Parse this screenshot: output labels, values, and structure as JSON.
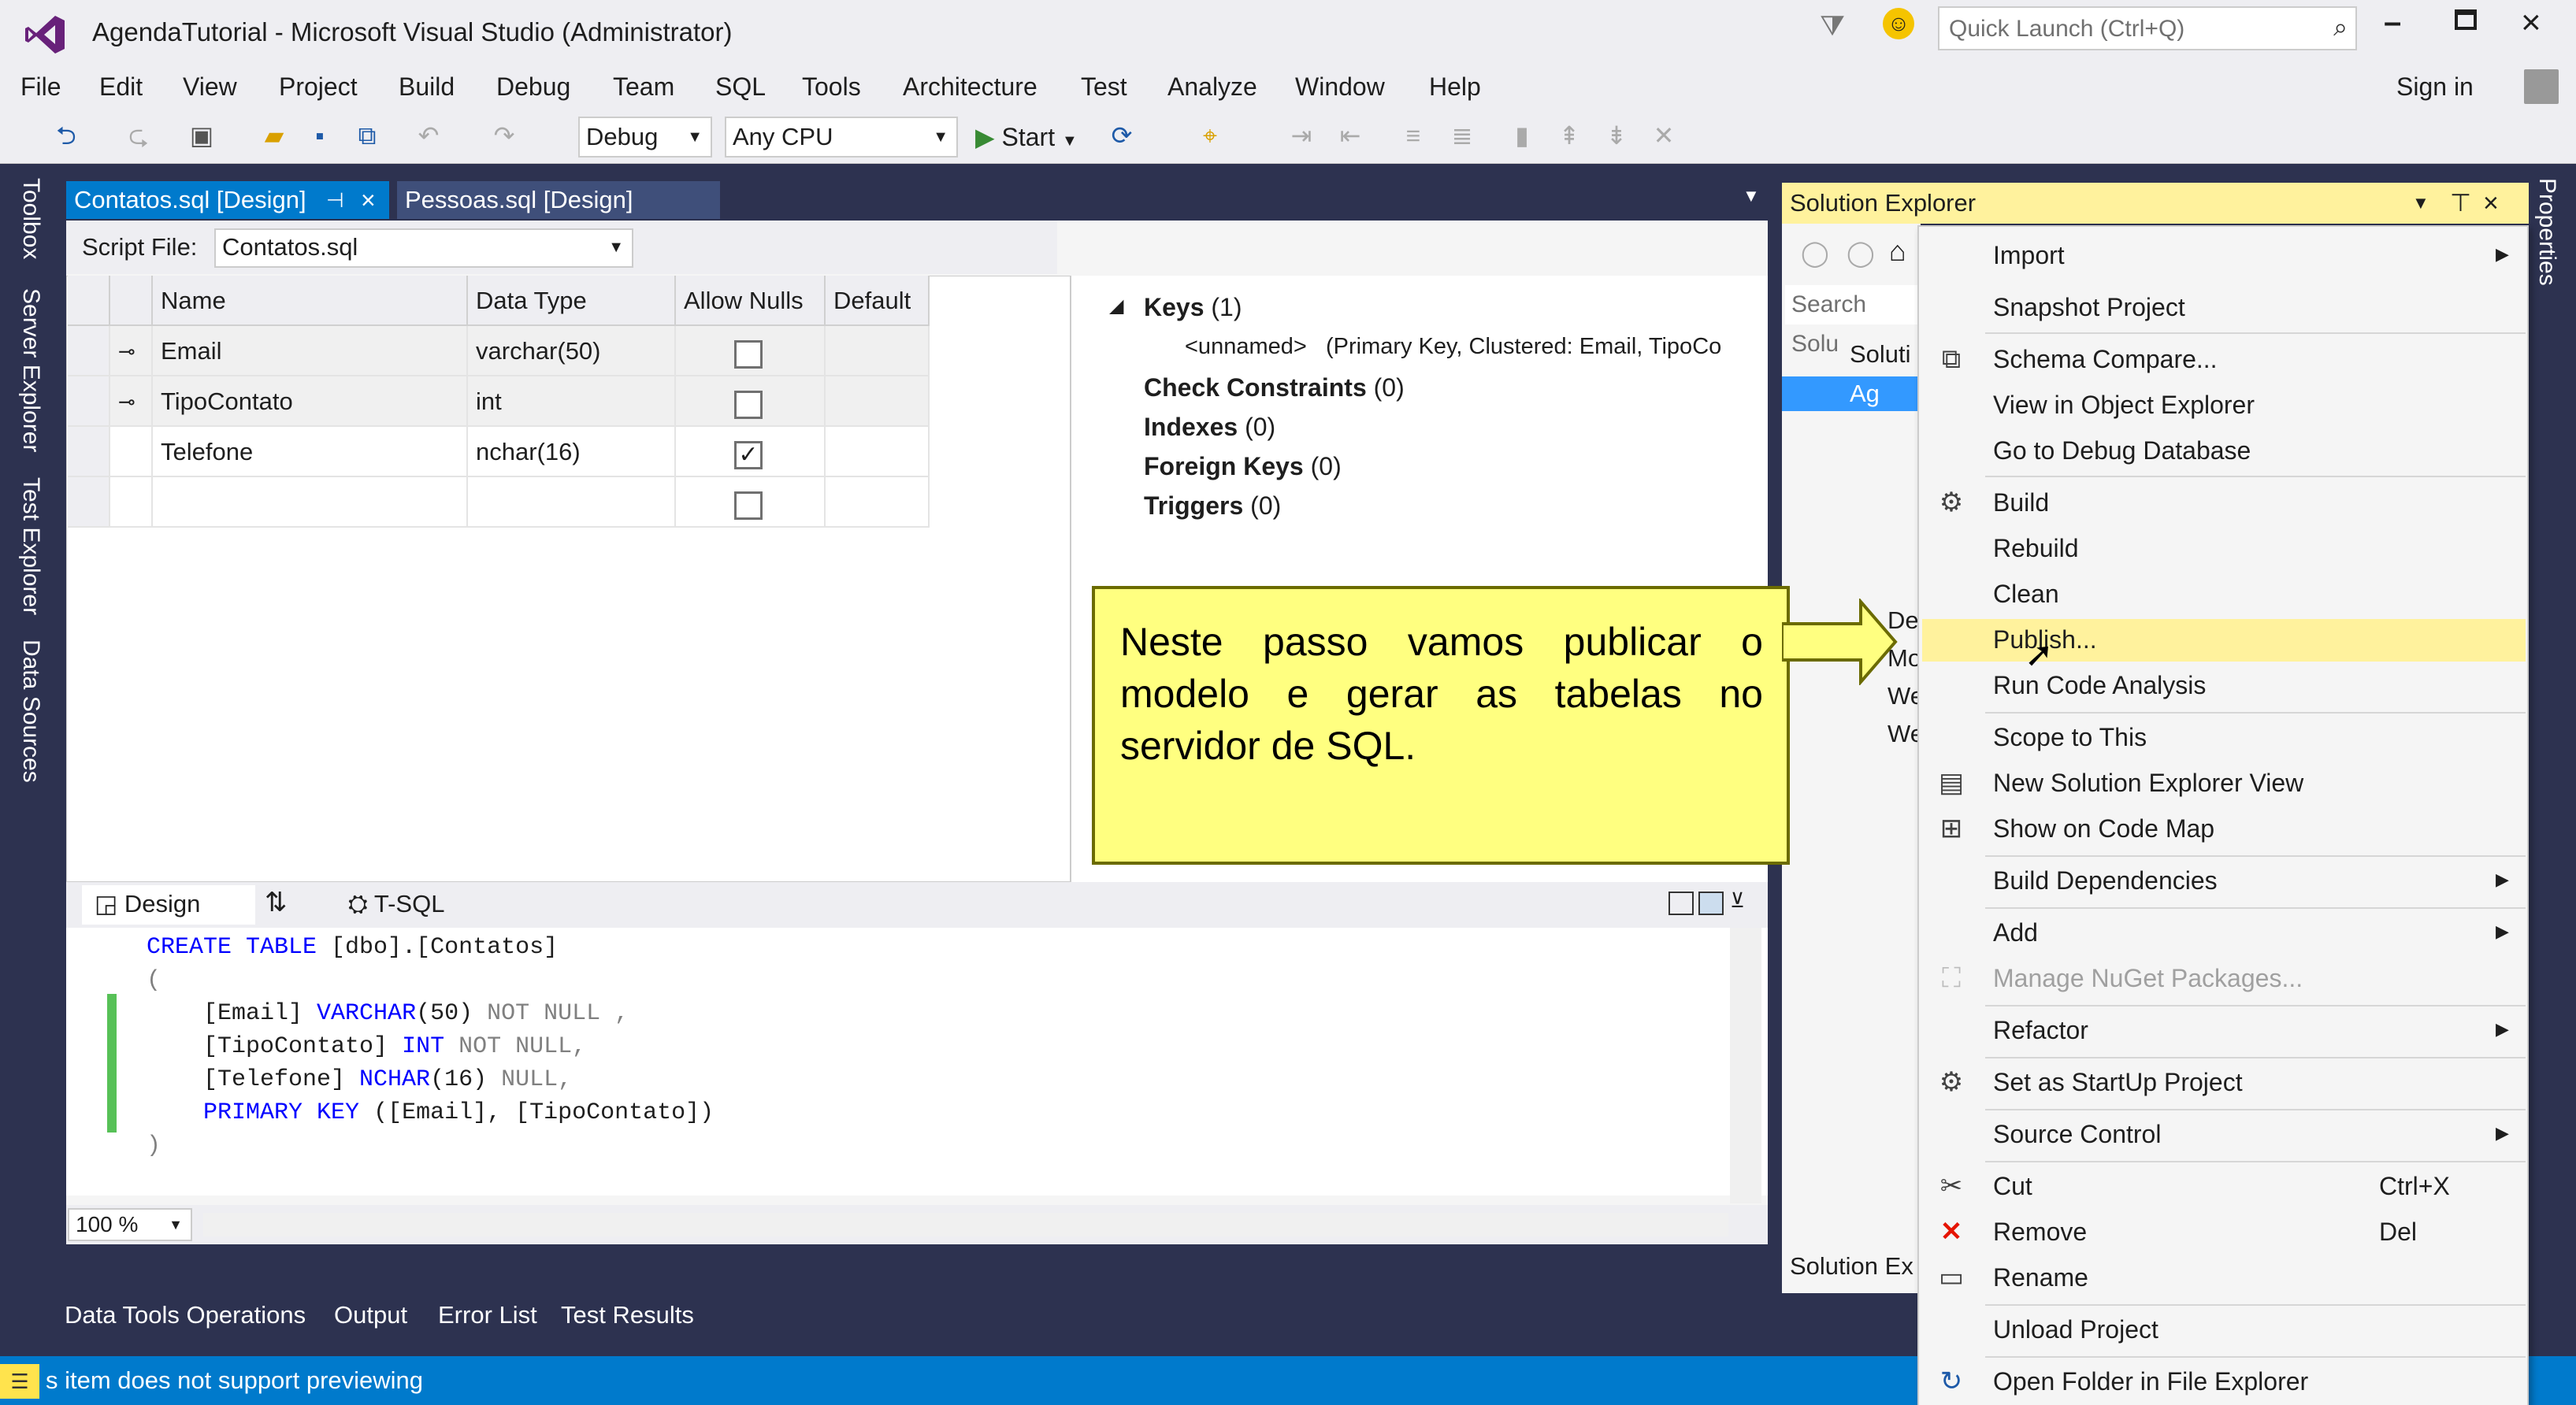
{
  "window": {
    "title": "AgendaTutorial - Microsoft Visual Studio (Administrator)",
    "quick_launch_placeholder": "Quick Launch (Ctrl+Q)",
    "sign_in": "Sign in"
  },
  "menu": [
    "File",
    "Edit",
    "View",
    "Project",
    "Build",
    "Debug",
    "Team",
    "SQL",
    "Tools",
    "Architecture",
    "Test",
    "Analyze",
    "Window",
    "Help"
  ],
  "toolbar": {
    "config": "Debug",
    "platform": "Any CPU",
    "start": "Start"
  },
  "left_tools": [
    "Toolbox",
    "Server Explorer",
    "Test Explorer",
    "Data Sources"
  ],
  "right_tools": [
    "Properties"
  ],
  "doc_tabs": [
    {
      "label": "Contatos.sql [Design]"
    },
    {
      "label": "Pessoas.sql [Design]"
    }
  ],
  "script_file": {
    "label": "Script File:",
    "value": "Contatos.sql"
  },
  "grid": {
    "headers": [
      "Name",
      "Data Type",
      "Allow Nulls",
      "Default"
    ],
    "rows": [
      {
        "name": "Email",
        "type": "varchar(50)",
        "allow_nulls": false,
        "key": true
      },
      {
        "name": "TipoContato",
        "type": "int",
        "allow_nulls": false,
        "key": true
      },
      {
        "name": "Telefone",
        "type": "nchar(16)",
        "allow_nulls": true,
        "key": false
      },
      {
        "name": "",
        "type": "",
        "allow_nulls": false,
        "key": false
      }
    ]
  },
  "props": {
    "keys": "Keys",
    "keys_count": "(1)",
    "unnamed": "<unnamed>",
    "unnamed_desc": "(Primary Key, Clustered: Email, TipoCo",
    "check": "Check Constraints",
    "check_count": "(0)",
    "indexes": "Indexes",
    "indexes_count": "(0)",
    "fks": "Foreign Keys",
    "fks_count": "(0)",
    "triggers": "Triggers",
    "triggers_count": "(0)"
  },
  "pane_tabs": {
    "design": "Design",
    "tsql": "T-SQL"
  },
  "code_lines": [
    "CREATE TABLE [dbo].[Contatos]",
    "(",
    "    [Email] VARCHAR(50) NOT NULL ,",
    "    [TipoContato] INT NOT NULL,",
    "    [Telefone] NCHAR(16) NULL,",
    "    PRIMARY KEY ([Email], [TipoContato])",
    ")"
  ],
  "zoom": "100 %",
  "bottom_tabs": [
    "Data Tools Operations",
    "Output",
    "Error List",
    "Test Results"
  ],
  "status": "s item does not support previewing",
  "solution_explorer": {
    "title": "Solution Explorer",
    "search": "Search Solu",
    "footer": "Solution Ex",
    "items": [
      "Soluti",
      "Ag",
      "De",
      "Mo",
      "We",
      "We"
    ]
  },
  "callout": "Neste passo vamos publicar o modelo e gerar as tabelas no servidor de SQL.",
  "context_menu": {
    "import": "Import",
    "snapshot": "Snapshot Project",
    "schema": "Schema Compare...",
    "view_obj": "View in Object Explorer",
    "goto_debug": "Go to Debug Database",
    "build": "Build",
    "rebuild": "Rebuild",
    "clean": "Clean",
    "publish": "Publish...",
    "code_analysis": "Run Code Analysis",
    "scope": "Scope to This",
    "new_view": "New Solution Explorer View",
    "code_map": "Show on Code Map",
    "build_deps": "Build Dependencies",
    "add": "Add",
    "nuget": "Manage NuGet Packages...",
    "refactor": "Refactor",
    "startup": "Set as StartUp Project",
    "source_control": "Source Control",
    "cut": "Cut",
    "cut_sc": "Ctrl+X",
    "remove": "Remove",
    "remove_sc": "Del",
    "rename": "Rename",
    "unload": "Unload Project",
    "open_folder": "Open Folder in File Explorer"
  }
}
